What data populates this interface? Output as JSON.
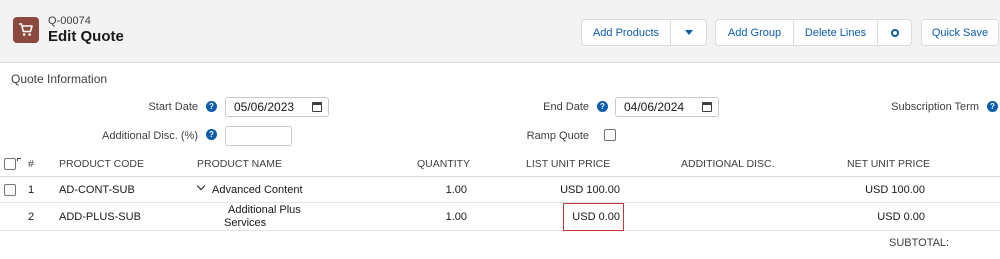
{
  "header": {
    "record_number": "Q-00074",
    "title": "Edit Quote",
    "icon": "cart-icon",
    "accent_color": "#8c4a3f"
  },
  "toolbar": {
    "add_products": "Add Products",
    "add_group": "Add Group",
    "delete_lines": "Delete Lines",
    "quick_save": "Quick Save"
  },
  "quote_info": {
    "section_title": "Quote Information",
    "start_date_label": "Start Date",
    "start_date_value": "05/06/2023",
    "end_date_label": "End Date",
    "end_date_value": "04/06/2024",
    "subscription_term_label": "Subscription Term",
    "additional_disc_label": "Additional Disc. (%)",
    "additional_disc_value": "",
    "ramp_quote_label": "Ramp Quote",
    "ramp_quote_checked": false
  },
  "table": {
    "columns": {
      "num": "#",
      "product_code": "PRODUCT CODE",
      "product_name": "PRODUCT NAME",
      "quantity": "QUANTITY",
      "list_unit_price": "LIST UNIT PRICE",
      "additional_disc": "ADDITIONAL DISC.",
      "net_unit_price": "NET UNIT PRICE"
    },
    "rows": [
      {
        "num": "1",
        "product_code": "AD-CONT-SUB",
        "product_name": "Advanced Content",
        "quantity": "1.00",
        "list_unit_price": "USD 100.00",
        "additional_disc": "",
        "net_unit_price": "USD 100.00"
      },
      {
        "num": "2",
        "product_code": "ADD-PLUS-SUB",
        "product_name_line1": "Additional Plus",
        "product_name_line2": "Services",
        "quantity": "1.00",
        "list_unit_price": "USD 0.00",
        "additional_disc": "",
        "net_unit_price": "USD 0.00"
      }
    ],
    "subtotal_label": "SUBTOTAL:"
  }
}
